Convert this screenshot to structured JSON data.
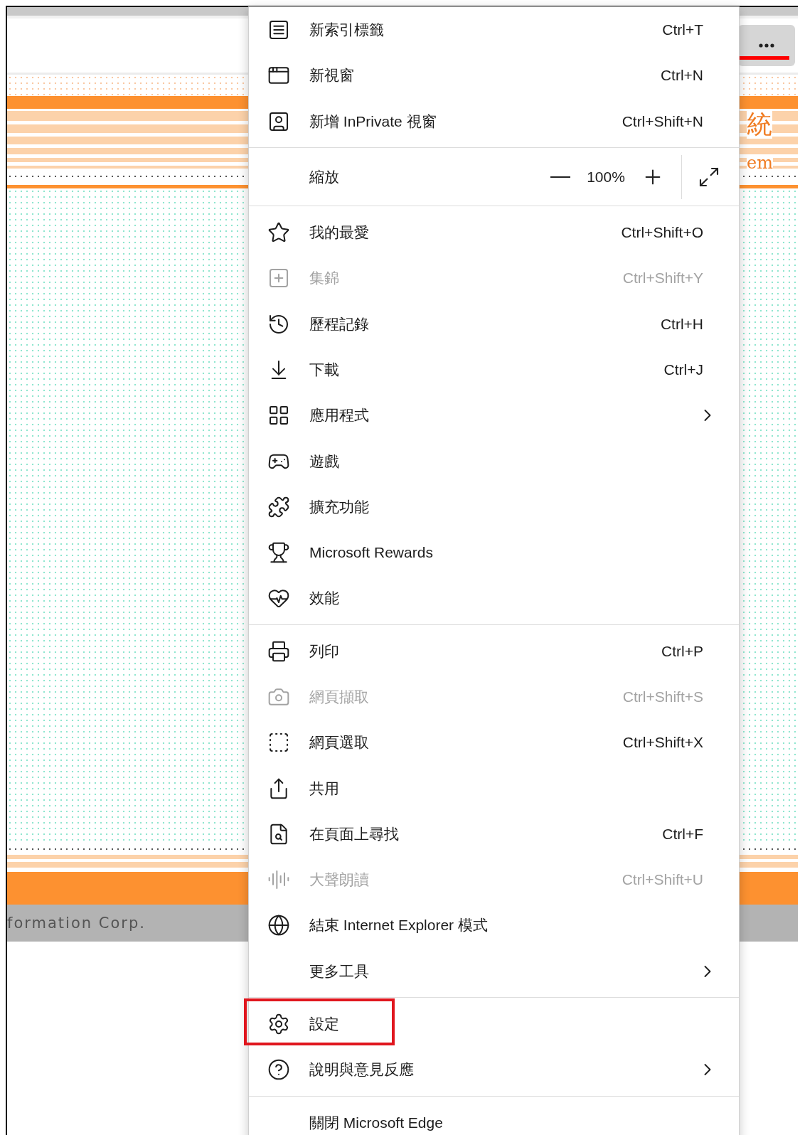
{
  "toolbar": {
    "more_button": {
      "highlighted": true
    }
  },
  "page": {
    "banner_title": "統",
    "banner_subtitle": "em",
    "footer_text": "formation Corp."
  },
  "menu": {
    "groups": [
      {
        "items": [
          {
            "kind": "command",
            "label": "新索引標籤",
            "shortcut": "Ctrl+T",
            "disabled": false,
            "submenu": false,
            "highlighted": false
          },
          {
            "kind": "command",
            "label": "新視窗",
            "shortcut": "Ctrl+N",
            "disabled": false,
            "submenu": false,
            "highlighted": false
          },
          {
            "kind": "command",
            "label": "新增 InPrivate 視窗",
            "shortcut": "Ctrl+Shift+N",
            "disabled": false,
            "submenu": false,
            "highlighted": false
          }
        ]
      },
      {
        "items": [
          {
            "kind": "zoom",
            "label": "縮放",
            "value": "100%"
          }
        ]
      },
      {
        "items": [
          {
            "kind": "command",
            "label": "我的最愛",
            "shortcut": "Ctrl+Shift+O",
            "disabled": false,
            "submenu": false,
            "highlighted": false
          },
          {
            "kind": "command",
            "label": "集錦",
            "shortcut": "Ctrl+Shift+Y",
            "disabled": true,
            "submenu": false,
            "highlighted": false
          },
          {
            "kind": "command",
            "label": "歷程記錄",
            "shortcut": "Ctrl+H",
            "disabled": false,
            "submenu": false,
            "highlighted": false
          },
          {
            "kind": "command",
            "label": "下載",
            "shortcut": "Ctrl+J",
            "disabled": false,
            "submenu": false,
            "highlighted": false
          },
          {
            "kind": "command",
            "label": "應用程式",
            "disabled": false,
            "submenu": true,
            "highlighted": false
          },
          {
            "kind": "command",
            "label": "遊戲",
            "disabled": false,
            "submenu": false,
            "highlighted": false
          },
          {
            "kind": "command",
            "label": "擴充功能",
            "disabled": false,
            "submenu": false,
            "highlighted": false
          },
          {
            "kind": "command",
            "label": "Microsoft Rewards",
            "disabled": false,
            "submenu": false,
            "highlighted": false
          },
          {
            "kind": "command",
            "label": "效能",
            "disabled": false,
            "submenu": false,
            "highlighted": false
          }
        ]
      },
      {
        "items": [
          {
            "kind": "command",
            "label": "列印",
            "shortcut": "Ctrl+P",
            "disabled": false,
            "submenu": false,
            "highlighted": false
          },
          {
            "kind": "command",
            "label": "網頁擷取",
            "shortcut": "Ctrl+Shift+S",
            "disabled": true,
            "submenu": false,
            "highlighted": false
          },
          {
            "kind": "command",
            "label": "網頁選取",
            "shortcut": "Ctrl+Shift+X",
            "disabled": false,
            "submenu": false,
            "highlighted": false
          },
          {
            "kind": "command",
            "label": "共用",
            "disabled": false,
            "submenu": false,
            "highlighted": false
          },
          {
            "kind": "command",
            "label": "在頁面上尋找",
            "shortcut": "Ctrl+F",
            "disabled": false,
            "submenu": false,
            "highlighted": false
          },
          {
            "kind": "command",
            "label": "大聲朗讀",
            "shortcut": "Ctrl+Shift+U",
            "disabled": true,
            "submenu": false,
            "highlighted": false
          },
          {
            "kind": "command",
            "label": "結束 Internet Explorer 模式",
            "disabled": false,
            "submenu": false,
            "highlighted": false
          },
          {
            "kind": "command",
            "label": "更多工具",
            "disabled": false,
            "submenu": true,
            "highlighted": false
          }
        ]
      },
      {
        "items": [
          {
            "kind": "command",
            "label": "設定",
            "disabled": false,
            "submenu": false,
            "highlighted": true
          },
          {
            "kind": "command",
            "label": "說明與意見反應",
            "disabled": false,
            "submenu": true,
            "highlighted": false
          }
        ]
      },
      {
        "items": [
          {
            "kind": "command",
            "label": "關閉 Microsoft Edge",
            "disabled": false,
            "submenu": false,
            "highlighted": false
          }
        ]
      }
    ]
  }
}
